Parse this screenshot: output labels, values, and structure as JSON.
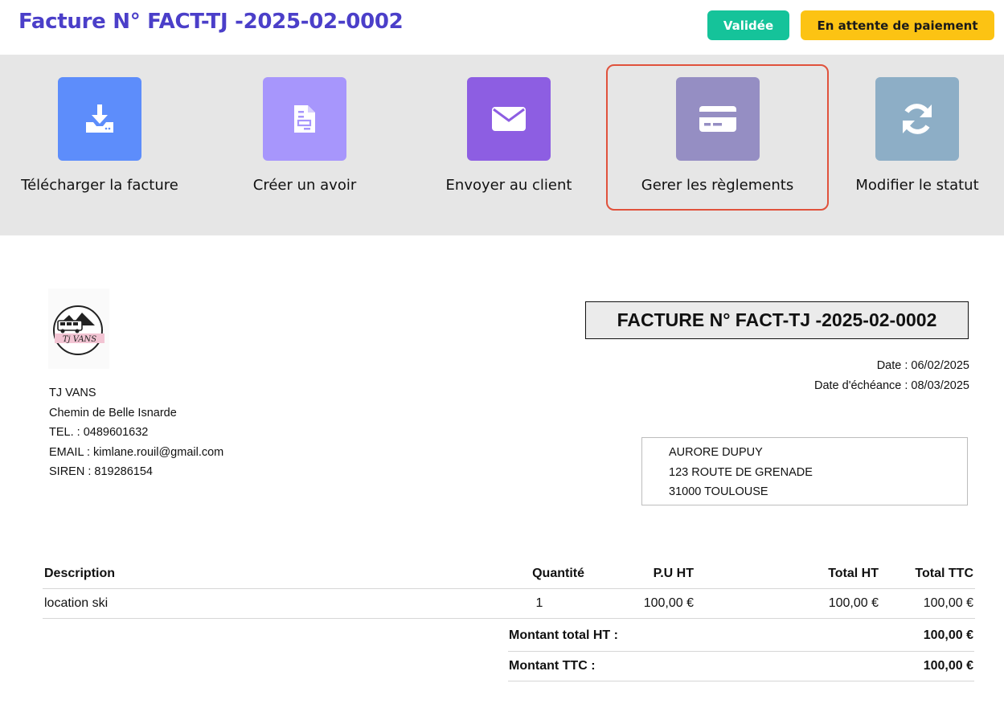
{
  "header": {
    "title": "Facture N° FACT-TJ -2025-02-0002",
    "badges": {
      "validated": "Validée",
      "payment": "En attente de paiement"
    }
  },
  "toolbar": {
    "actions": [
      {
        "label": "Télécharger la facture",
        "icon": "download-icon",
        "color": "#5d8dfb"
      },
      {
        "label": "Créer un avoir",
        "icon": "document-icon",
        "color": "#a796fc"
      },
      {
        "label": "Envoyer au client",
        "icon": "envelope-icon",
        "color": "#8d5ee2"
      },
      {
        "label": "Gerer les règlements",
        "icon": "credit-card-icon",
        "color": "#958ec3",
        "highlighted": true
      },
      {
        "label": "Modifier le statut",
        "icon": "refresh-icon",
        "color": "#8daec6"
      }
    ]
  },
  "invoice": {
    "logo_text": "Tj VANS",
    "title": "FACTURE N° FACT-TJ -2025-02-0002",
    "date": "Date : 06/02/2025",
    "due_date": "Date d'échéance : 08/03/2025",
    "company": {
      "name": "TJ VANS",
      "address": "Chemin de Belle Isnarde",
      "tel": "TEL. : 0489601632",
      "email": "EMAIL : kimlane.rouil@gmail.com",
      "siren": "SIREN : 819286154"
    },
    "client": {
      "name": "AURORE DUPUY",
      "street": "123 ROUTE DE GRENADE",
      "city": "31000 TOULOUSE"
    },
    "columns": {
      "description": "Description",
      "quantity": "Quantité",
      "unit_price": "P.U HT",
      "total_ht": "Total HT",
      "total_ttc": "Total TTC"
    },
    "items": [
      {
        "description": "location ski",
        "quantity": "1",
        "unit_price": "100,00 €",
        "total_ht": "100,00 €",
        "total_ttc": "100,00 €"
      }
    ],
    "totals": {
      "ht_label": "Montant total HT :",
      "ht_value": "100,00 €",
      "ttc_label": "Montant TTC :",
      "ttc_value": "100,00 €"
    }
  }
}
